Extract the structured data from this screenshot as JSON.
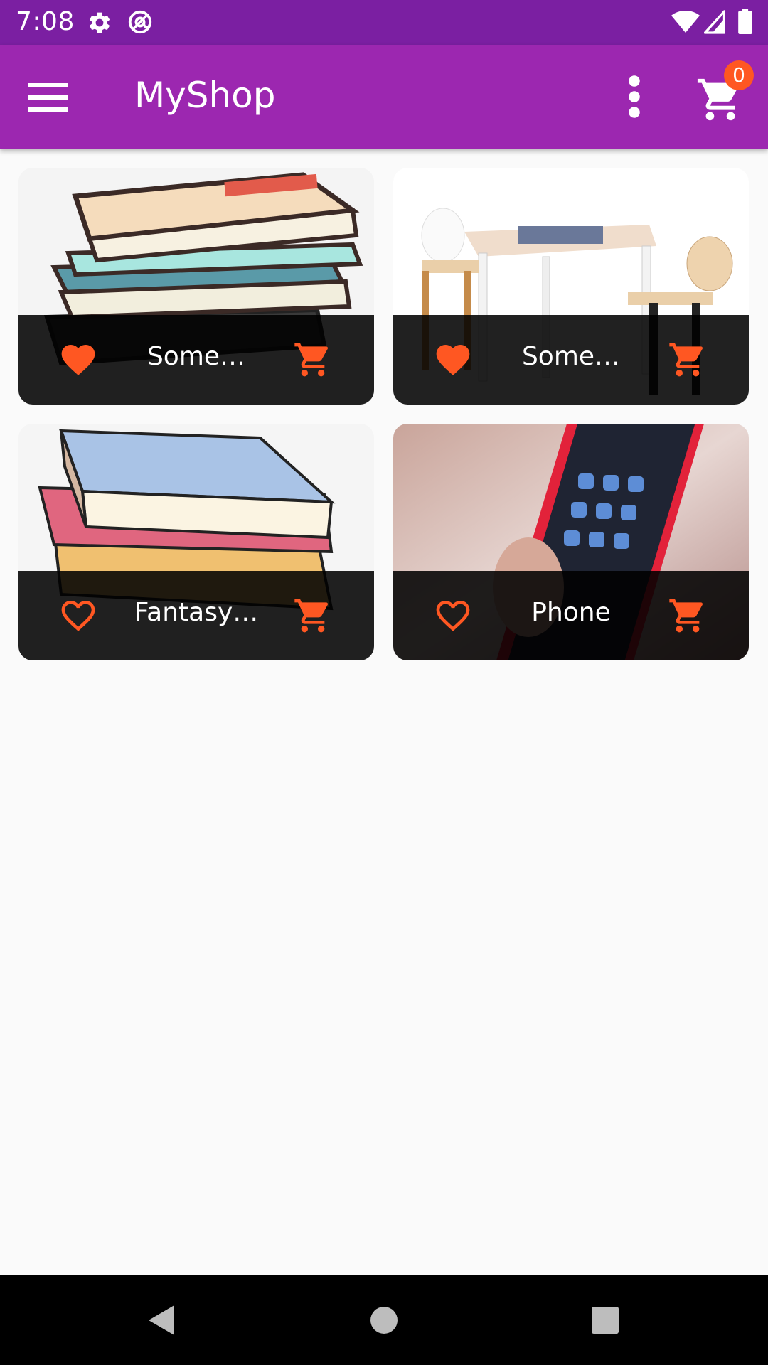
{
  "status_bar": {
    "time": "7:08",
    "icons": [
      "settings-icon",
      "at-sign-icon",
      "wifi-icon",
      "signal-icon",
      "battery-icon"
    ]
  },
  "app_bar": {
    "title": "MyShop",
    "menu_icon": "hamburger-menu-icon",
    "more_icon": "more-vertical-icon",
    "cart_icon": "shopping-cart-icon",
    "cart_count": "0"
  },
  "products": [
    {
      "title": "Some…",
      "favorite": true,
      "image": "stack of books illustration"
    },
    {
      "title": "Some…",
      "favorite": true,
      "image": "children table and chairs"
    },
    {
      "title": "Fantasy…",
      "favorite": false,
      "image": "stack of colorful books illustration"
    },
    {
      "title": "Phone",
      "favorite": false,
      "image": "hand holding smartphone"
    }
  ],
  "colors": {
    "status_bar": "#7b1fa2",
    "app_bar": "#9c27b0",
    "accent": "#ff5722",
    "background": "#fafafa",
    "card_footer": "#1a1a1a"
  },
  "nav_bar": {
    "icons": [
      "back-icon",
      "home-icon",
      "recents-icon"
    ]
  }
}
